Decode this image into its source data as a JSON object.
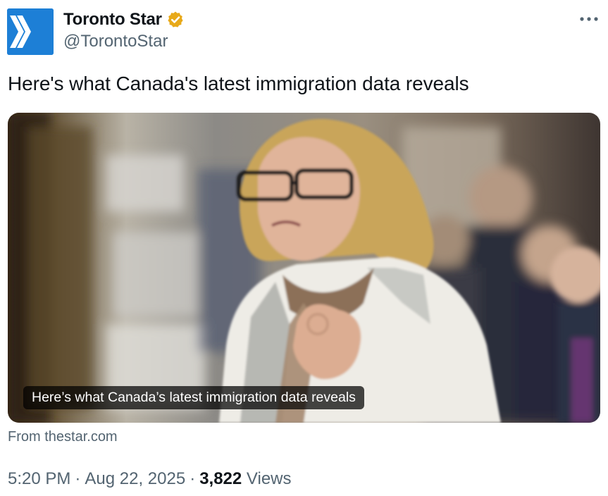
{
  "author": {
    "display_name": "Toronto Star",
    "handle": "@TorontoStar",
    "avatar_icon": "toronto-star-chevron-logo",
    "verified_icon": "verified-gold-badge-icon",
    "brand_color": "#1d7fd6",
    "badge_color": "#e8a919"
  },
  "menu": {
    "more_icon": "more-horizontal-icon"
  },
  "tweet": {
    "text": "Here's what Canada's latest immigration data reveals"
  },
  "card": {
    "caption": "Here’s what Canada’s latest immigration data reveals",
    "source": "From thestar.com"
  },
  "meta": {
    "time": "5:20 PM",
    "separator": "·",
    "date": "Aug 22, 2025",
    "views_count": "3,822",
    "views_label": "Views"
  }
}
